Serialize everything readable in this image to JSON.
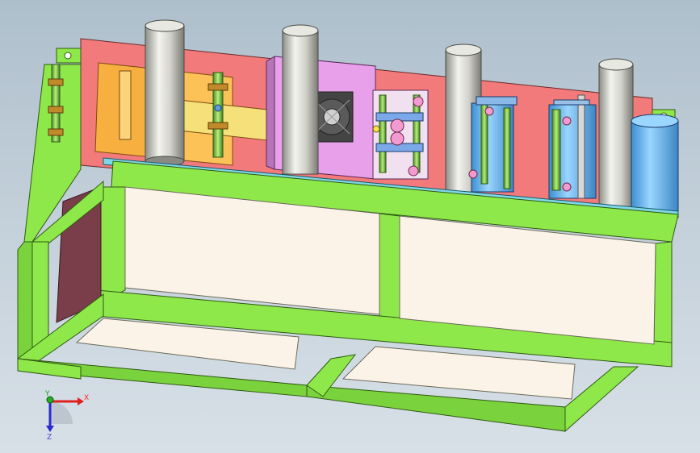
{
  "viewport": {
    "background_top": "#aebfcc",
    "background_bottom": "#d8e0e7"
  },
  "model": {
    "frame_color": "#8fe84a",
    "frame_edge_color": "#2e5a12",
    "back_plate_color": "#f27a7a",
    "panel_color": "#fcf3e8",
    "top_plate_color": "#7fd8e6",
    "side_panel_color": "#7a3d4a",
    "column_color": "#c8c8c0",
    "motor_housing_color": "#e9a0ea",
    "bracket_color": "#f7b040",
    "cylinder_color": "#58b6f0"
  },
  "triad": {
    "x_label": "X",
    "y_label": "Y",
    "z_label": "Z",
    "x_color": "#e02020",
    "y_color": "#20b020",
    "z_color": "#2a2ad0"
  }
}
